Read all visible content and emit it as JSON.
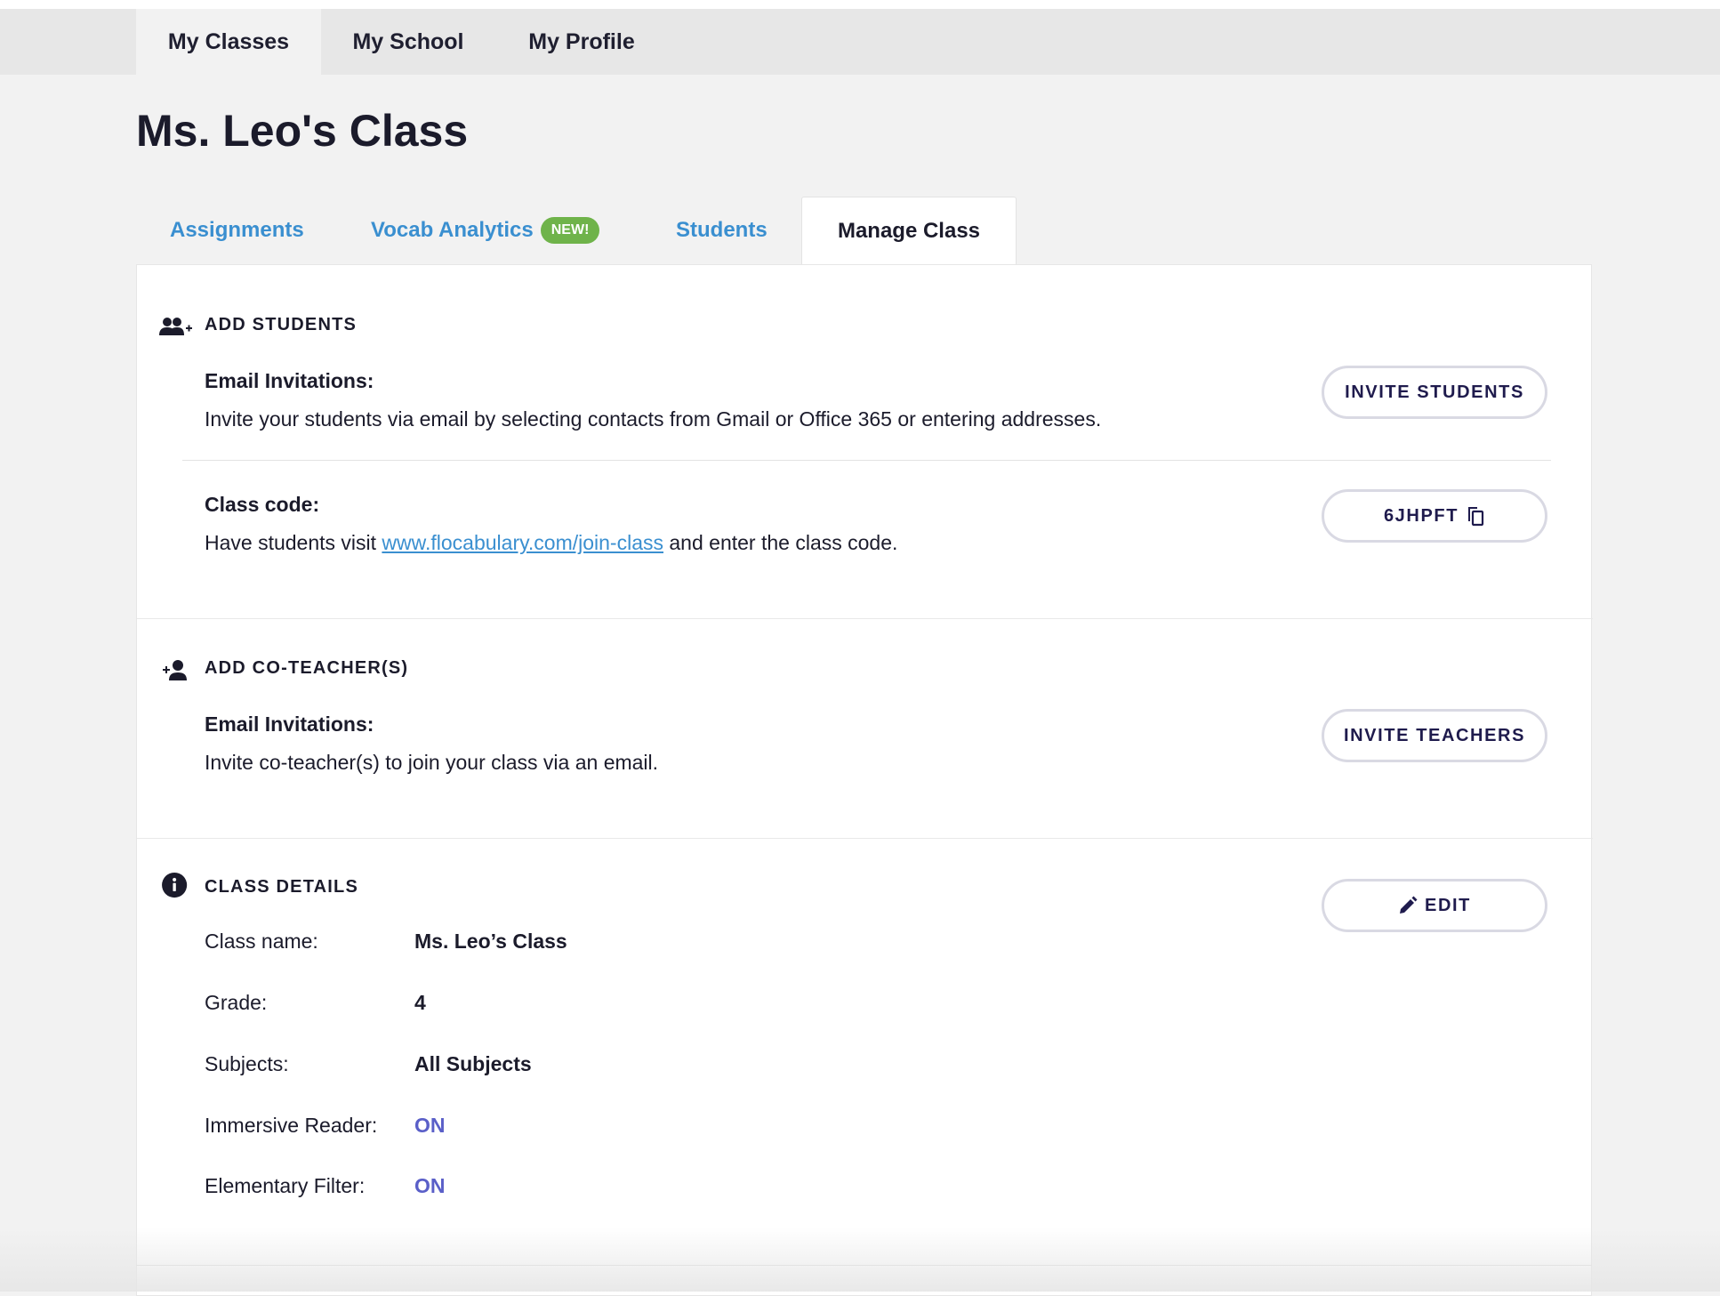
{
  "topnav": {
    "items": [
      {
        "label": "My Classes",
        "active": true
      },
      {
        "label": "My School",
        "active": false
      },
      {
        "label": "My Profile",
        "active": false
      }
    ]
  },
  "page": {
    "title": "Ms. Leo's Class"
  },
  "tabs": {
    "assignments": "Assignments",
    "vocab": "Vocab Analytics",
    "vocab_badge": "NEW!",
    "students": "Students",
    "manage": "Manage Class"
  },
  "add_students": {
    "heading": "ADD STUDENTS",
    "icon": "users-plus-icon",
    "email_label": "Email Invitations:",
    "email_desc": "Invite your students via email by selecting contacts from Gmail or Office 365 or entering addresses.",
    "invite_button": "INVITE STUDENTS",
    "code_label": "Class code:",
    "code_desc_before": "Have students visit ",
    "code_link": "www.flocabulary.com/join-class",
    "code_desc_after": " and enter the class code.",
    "code_value": "6JHPFT"
  },
  "add_coteachers": {
    "heading": "ADD CO-TEACHER(S)",
    "icon": "user-plus-icon",
    "email_label": "Email Invitations:",
    "email_desc": "Invite co-teacher(s) to join your class via an email.",
    "invite_button": "INVITE TEACHERS"
  },
  "class_details": {
    "heading": "CLASS DETAILS",
    "icon": "info-icon",
    "edit_button": "EDIT",
    "rows": [
      {
        "label": "Class name:",
        "value": "Ms. Leo’s Class"
      },
      {
        "label": "Grade:",
        "value": "4"
      },
      {
        "label": "Subjects:",
        "value": "All Subjects"
      },
      {
        "label": "Immersive Reader:",
        "value": "ON"
      },
      {
        "label": "Elementary Filter:",
        "value": "ON"
      }
    ]
  },
  "colors": {
    "accent_blue": "#3a8fd0",
    "badge_green": "#6fb34a",
    "on_purple": "#5a5fc8",
    "button_text": "#1f1b4d"
  }
}
